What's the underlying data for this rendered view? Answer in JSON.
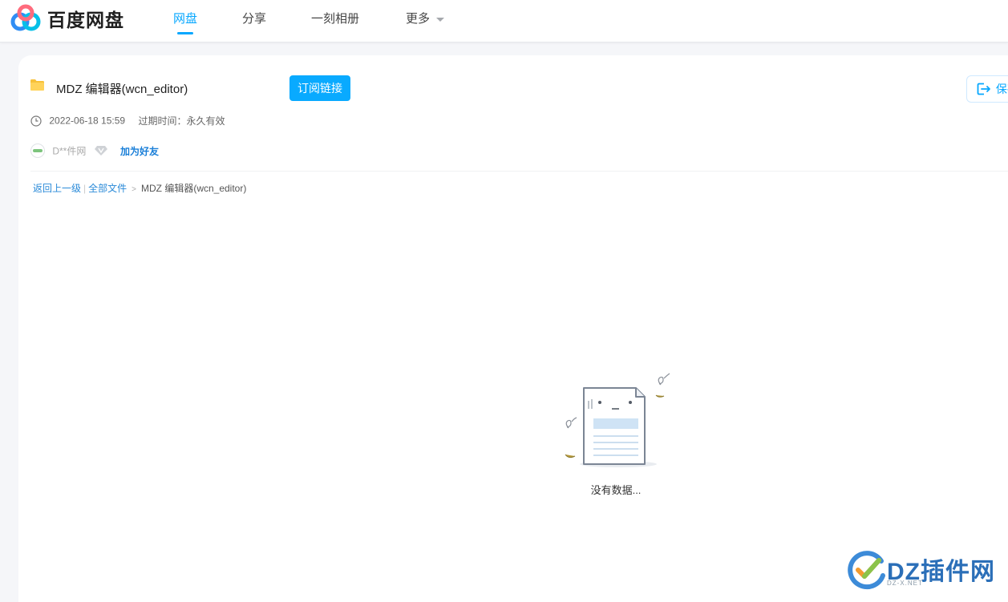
{
  "header": {
    "brand": "百度网盘",
    "nav": [
      {
        "label": "网盘",
        "active": true
      },
      {
        "label": "分享"
      },
      {
        "label": "一刻相册"
      },
      {
        "label": "更多"
      }
    ],
    "accent_color": "#06a7ff"
  },
  "share": {
    "folder_name": "MDZ 编辑器(wcn_editor)",
    "subscribe_label": "订阅链接",
    "save_label": "保存",
    "date": "2022-06-18 15:59",
    "expire": "过期时间：永久有效",
    "user_name": "D**件网",
    "add_friend": "加为好友"
  },
  "breadcrumb": {
    "back": "返回上一级",
    "all_files": "全部文件",
    "sep": ">",
    "current": "MDZ 编辑器(wcn_editor)"
  },
  "empty": {
    "text": "没有数据..."
  },
  "watermark": {
    "text": "DZ插件网",
    "sub": "DZ-X.NET"
  }
}
